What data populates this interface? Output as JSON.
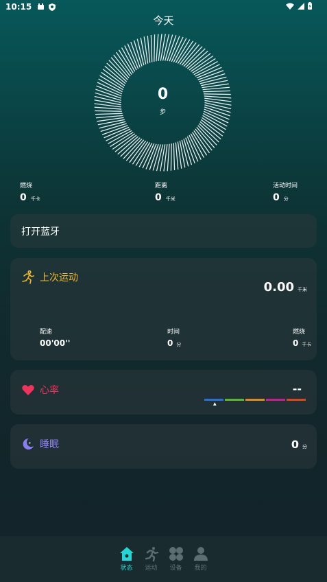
{
  "status_bar": {
    "time": "10:15"
  },
  "header": {
    "title": "今天"
  },
  "ring": {
    "steps": "0",
    "unit": "步"
  },
  "summary": [
    {
      "label": "燃烧",
      "value": "0",
      "unit": "千卡"
    },
    {
      "label": "距离",
      "value": "0",
      "unit": "千米"
    },
    {
      "label": "活动时间",
      "value": "0",
      "unit": "分"
    }
  ],
  "bluetooth": {
    "label": "打开蓝牙"
  },
  "exercise": {
    "title": "上次运动",
    "distance": "0.00",
    "distance_unit": "千米",
    "stats": [
      {
        "label": "配速",
        "value": "00'00''",
        "unit": ""
      },
      {
        "label": "时间",
        "value": "0",
        "unit": "分"
      },
      {
        "label": "燃烧",
        "value": "0",
        "unit": "千卡"
      }
    ],
    "accent": "#f0b92c"
  },
  "heart_rate": {
    "title": "心率",
    "value": "--",
    "accent": "#f0325d",
    "bar_colors": [
      "#2a6fd6",
      "#5fb52f",
      "#e08a22",
      "#c4228a",
      "#d8481b"
    ]
  },
  "sleep": {
    "title": "睡眠",
    "value": "0",
    "unit": "分",
    "accent": "#8b7cf2"
  },
  "nav": {
    "items": [
      {
        "label": "状态",
        "icon": "home-icon",
        "active": true
      },
      {
        "label": "运动",
        "icon": "runner-icon",
        "active": false
      },
      {
        "label": "设备",
        "icon": "device-icon",
        "active": false
      },
      {
        "label": "我的",
        "icon": "person-icon",
        "active": false
      }
    ],
    "active_color": "#21d6d6",
    "inactive_color": "#5d6e72"
  }
}
